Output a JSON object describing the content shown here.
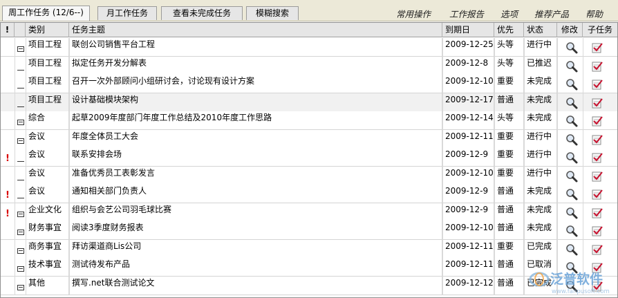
{
  "tabs": [
    {
      "label": "周工作任务 (12/6--)"
    },
    {
      "label": "月工作任务"
    },
    {
      "label": "查看未完成任务"
    },
    {
      "label": "模糊搜索"
    }
  ],
  "menu": [
    {
      "label": "常用操作"
    },
    {
      "label": "工作报告"
    },
    {
      "label": "选项"
    },
    {
      "label": "推荐产品"
    },
    {
      "label": "帮助"
    }
  ],
  "headers": {
    "flag": "!",
    "category": "类别",
    "subject": "任务主题",
    "due": "到期日",
    "priority": "优先",
    "status": "状态",
    "edit": "修改",
    "subtask": "子任务"
  },
  "rows": [
    {
      "flag": "",
      "node": "expander",
      "category": "项目工程",
      "subject": "联创公司销售平台工程",
      "due": "2009-12-25",
      "priority": "头等",
      "status": "进行中"
    },
    {
      "flag": "",
      "node": "leaf",
      "category": "项目工程",
      "subject": "拟定任务开发分解表",
      "due": "2009-12-8",
      "priority": "头等",
      "status": "已推迟"
    },
    {
      "flag": "",
      "node": "leaf",
      "category": "项目工程",
      "subject": "召开一次外部顾问小组研讨会，讨论现有设计方案",
      "due": "2009-12-10",
      "priority": "重要",
      "status": "未完成"
    },
    {
      "flag": "",
      "node": "leaf",
      "category": "项目工程",
      "subject": "设计基础模块架构",
      "due": "2009-12-17",
      "priority": "普通",
      "status": "未完成"
    },
    {
      "flag": "",
      "node": "expander",
      "category": "综合",
      "subject": "起草2009年度部门年度工作总结及2010年度工作思路",
      "due": "2009-12-14",
      "priority": "头等",
      "status": "未完成"
    },
    {
      "flag": "",
      "node": "expander",
      "category": "会议",
      "subject": "年度全体员工大会",
      "due": "2009-12-11",
      "priority": "重要",
      "status": "进行中"
    },
    {
      "flag": "!",
      "node": "leaf",
      "category": "会议",
      "subject": "联系安排会场",
      "due": "2009-12-9",
      "priority": "重要",
      "status": "进行中"
    },
    {
      "flag": "",
      "node": "leaf",
      "category": "会议",
      "subject": "准备优秀员工表彰发言",
      "due": "2009-12-10",
      "priority": "重要",
      "status": "进行中"
    },
    {
      "flag": "!",
      "node": "leaf",
      "category": "会议",
      "subject": "通知相关部门负责人",
      "due": "2009-12-9",
      "priority": "普通",
      "status": "未完成"
    },
    {
      "flag": "!",
      "node": "expander",
      "category": "企业文化",
      "subject": "组织与会艺公司羽毛球比赛",
      "due": "2009-12-9",
      "priority": "普通",
      "status": "未完成"
    },
    {
      "flag": "",
      "node": "expander",
      "category": "财务事宜",
      "subject": "阅读3季度财务报表",
      "due": "2009-12-10",
      "priority": "普通",
      "status": "未完成"
    },
    {
      "flag": "",
      "node": "expander",
      "category": "商务事宜",
      "subject": "拜访渠道商Lis公司",
      "due": "2009-12-11",
      "priority": "重要",
      "status": "已完成"
    },
    {
      "flag": "",
      "node": "expander",
      "category": "技术事宜",
      "subject": "测试待发布产品",
      "due": "2009-12-11",
      "priority": "普通",
      "status": "已取消"
    },
    {
      "flag": "",
      "node": "expander",
      "category": "其他",
      "subject": "撰写.net联合测试论文",
      "due": "2009-12-12",
      "priority": "普通",
      "status": "已完成"
    }
  ],
  "highlight_row": 3,
  "watermark": {
    "brand": "泛普软件",
    "url": "www.fanpusoft.com"
  },
  "colors": {
    "tab_bg": "#e6e6e6",
    "flag": "#d90000",
    "check": "#c8102e"
  }
}
